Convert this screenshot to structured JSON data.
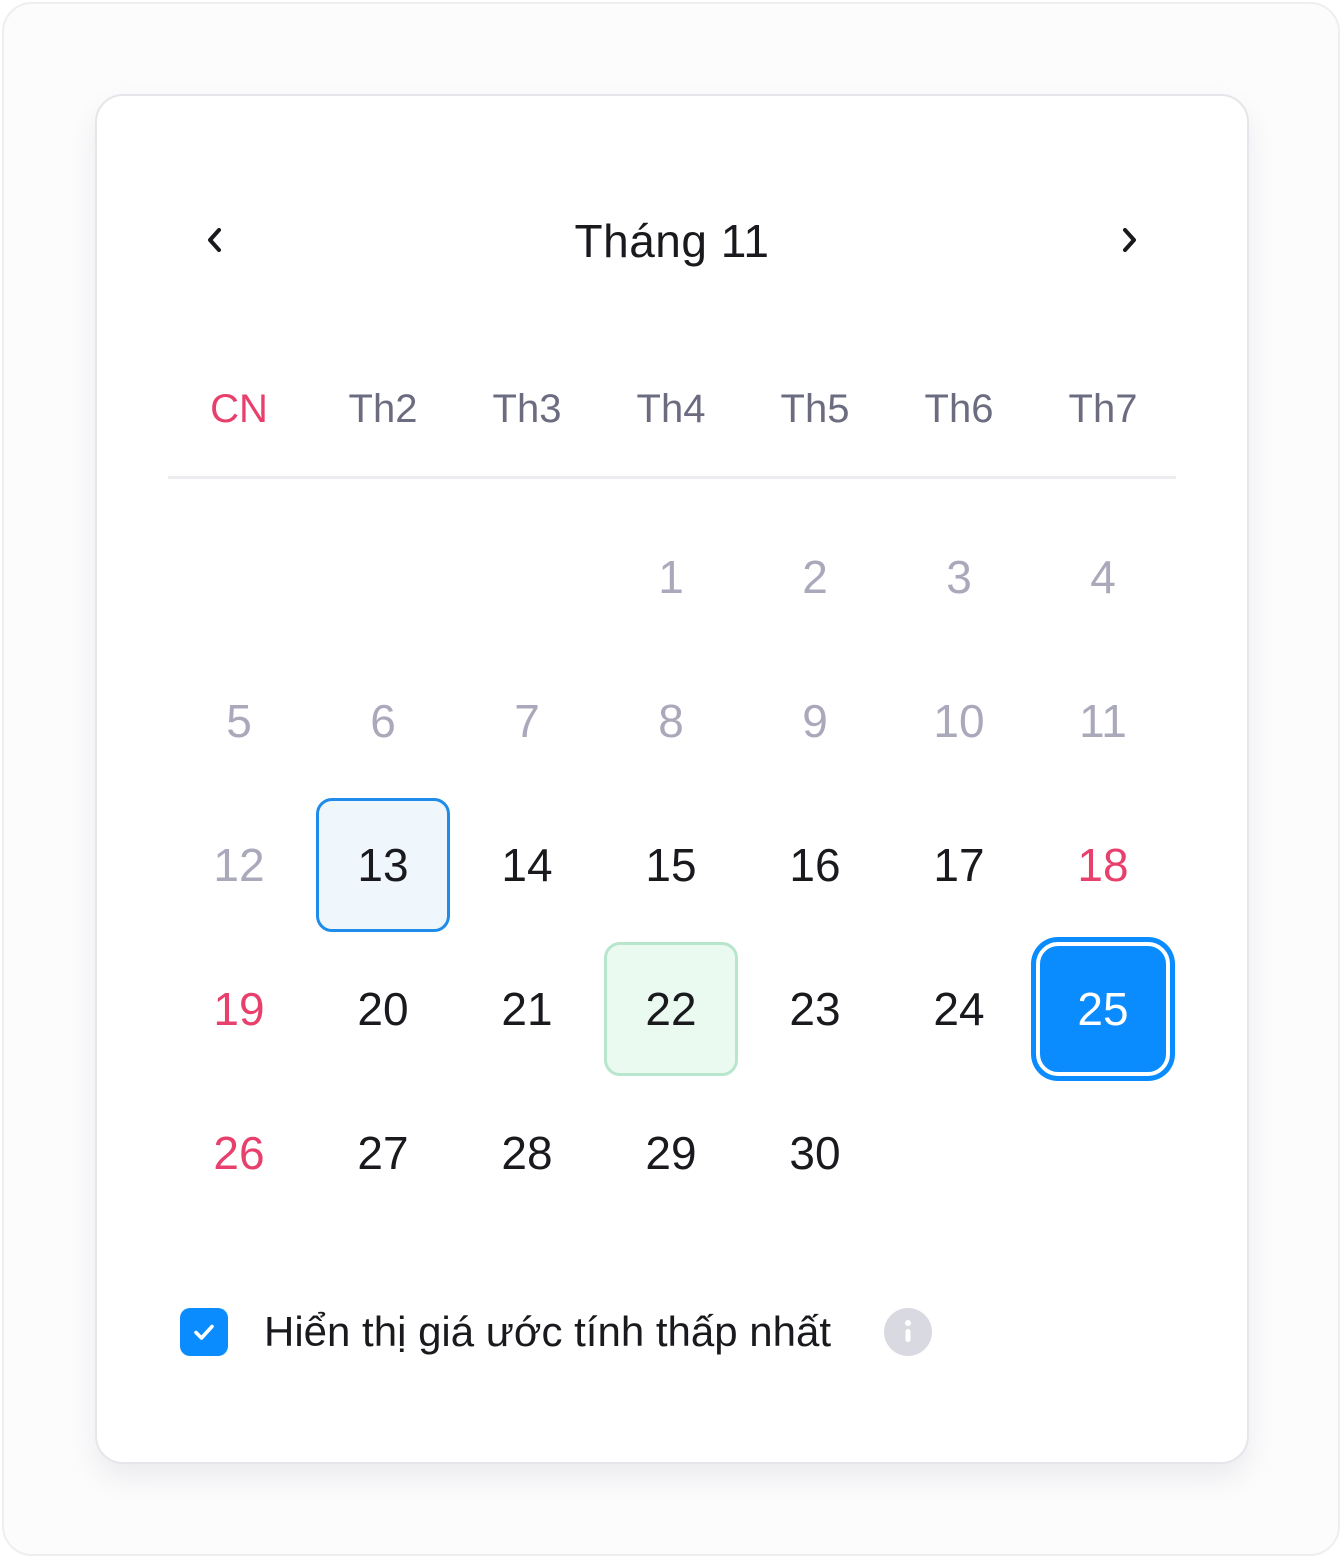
{
  "calendar": {
    "month_title": "Tháng 11",
    "prev_icon": "chevron-left-icon",
    "next_icon": "chevron-right-icon",
    "weekdays": [
      "CN",
      "Th2",
      "Th3",
      "Th4",
      "Th5",
      "Th6",
      "Th7"
    ],
    "days": [
      "1",
      "2",
      "3",
      "4",
      "5",
      "6",
      "7",
      "8",
      "9",
      "10",
      "11",
      "12",
      "13",
      "14",
      "15",
      "16",
      "17",
      "18",
      "19",
      "20",
      "21",
      "22",
      "23",
      "24",
      "25",
      "26",
      "27",
      "28",
      "29",
      "30"
    ],
    "first_weekday_index": 3,
    "past_days_through": 12,
    "today": 13,
    "highlighted_day": 22,
    "selected_day": 25,
    "red_days": [
      18,
      19,
      26
    ]
  },
  "option": {
    "checked": true,
    "label": "Hiển thị giá ước tính thấp nhất",
    "info_icon": "info-icon"
  },
  "colors": {
    "accent": "#0a8cff",
    "sunday": "#e8406c",
    "muted": "#a9a9bb",
    "highlight_green": "#eafaf1"
  }
}
